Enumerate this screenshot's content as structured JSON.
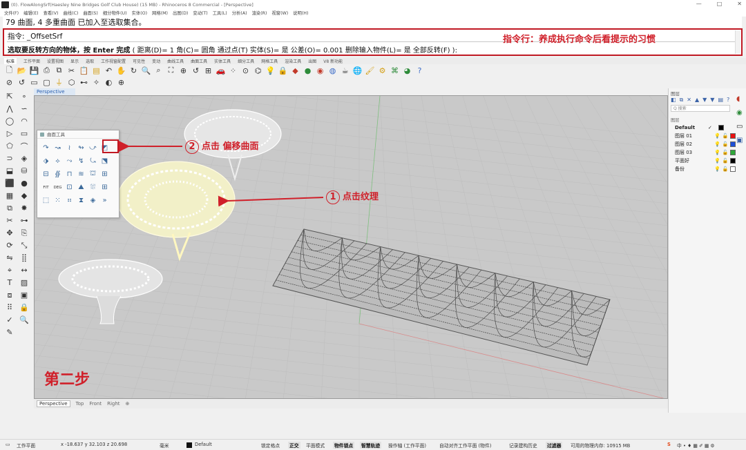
{
  "window": {
    "title": "(0). FlowAlongSrf(Haesley Nine Bridges Golf Club House) (15 MB) - Rhinoceros 8 Commercial - [Perspective]",
    "controls": [
      "—",
      "□",
      "✕"
    ]
  },
  "menu": [
    "文件(F)",
    "编辑(E)",
    "查看(V)",
    "曲线(C)",
    "曲面(S)",
    "细分物件(U)",
    "实体(O)",
    "网格(M)",
    "出图(D)",
    "变动(T)",
    "工具(L)",
    "分析(A)",
    "渲染(R)",
    "视窗(W)",
    "说明(H)"
  ],
  "command": {
    "history": "79 曲面, 4 多重曲面 已加入至选取集合。",
    "prompt": "指令: _OffsetSrf",
    "line2_bold": "选取要反转方向的物体，按 Enter 完成",
    "line2_opts": "( 距离(D)= 1  角(C)= 圆角  通过点(T)  实体(S)= 是  公差(O)= 0.001  删除输入物件(L)= 是  全部反转(F) ):",
    "annotation": "指令行：养成执行命令后看提示的习惯"
  },
  "toolbar_tabs": [
    "标准",
    "工作平面",
    "设置视图",
    "显示",
    "选取",
    "工作视窗配置",
    "可见性",
    "变动",
    "曲线工具",
    "曲面工具",
    "实体工具",
    "细分工具",
    "网格工具",
    "渲染工具",
    "出图",
    "V8 新功能"
  ],
  "toolbar_row1": [
    {
      "icon": "new-file-icon",
      "g": "🗋",
      "c": ""
    },
    {
      "icon": "open-icon",
      "g": "📂",
      "c": "c4"
    },
    {
      "icon": "save-icon",
      "g": "💾",
      "c": "c1"
    },
    {
      "icon": "print-icon",
      "g": "⎙",
      "c": ""
    },
    {
      "icon": "copy-icon",
      "g": "⧉",
      "c": ""
    },
    {
      "icon": "cut-icon",
      "g": "✂",
      "c": ""
    },
    {
      "icon": "paste-icon",
      "g": "📋",
      "c": ""
    },
    {
      "icon": "clipboard-icon",
      "g": "▤",
      "c": "c4"
    },
    {
      "icon": "undo-icon",
      "g": "↶",
      "c": ""
    },
    {
      "icon": "pan-icon",
      "g": "✋",
      "c": ""
    },
    {
      "icon": "rotate-icon",
      "g": "↻",
      "c": ""
    },
    {
      "icon": "zoom-icon",
      "g": "🔍",
      "c": ""
    },
    {
      "icon": "zoom-window-icon",
      "g": "⌕",
      "c": ""
    },
    {
      "icon": "zoom-extents-icon",
      "g": "⛶",
      "c": ""
    },
    {
      "icon": "zoom-selected-icon",
      "g": "⊕",
      "c": ""
    },
    {
      "icon": "undo-view-icon",
      "g": "↺",
      "c": ""
    },
    {
      "icon": "four-view-icon",
      "g": "⊞",
      "c": ""
    },
    {
      "icon": "car-icon",
      "g": "🚗",
      "c": "c2"
    },
    {
      "icon": "points-icon",
      "g": "⁘",
      "c": ""
    },
    {
      "icon": "snap-icon",
      "g": "⊙",
      "c": ""
    },
    {
      "icon": "cplane-icon",
      "g": "⌬",
      "c": ""
    },
    {
      "icon": "lightbulb-icon",
      "g": "💡",
      "c": "c4"
    },
    {
      "icon": "lock-icon",
      "g": "🔒",
      "c": ""
    },
    {
      "icon": "material-icon",
      "g": "◆",
      "c": "c2"
    },
    {
      "icon": "sphere-color-icon",
      "g": "●",
      "c": "c3"
    },
    {
      "icon": "render-sphere-icon",
      "g": "◉",
      "c": "c2"
    },
    {
      "icon": "environment-icon",
      "g": "◍",
      "c": "c1"
    },
    {
      "icon": "teapot-icon",
      "g": "☕",
      "c": ""
    },
    {
      "icon": "globe-icon",
      "g": "🌐",
      "c": "c1"
    },
    {
      "icon": "brush-icon",
      "g": "🖌",
      "c": "c4"
    },
    {
      "icon": "gear-icon",
      "g": "⚙",
      "c": "c4"
    },
    {
      "icon": "grasshopper-icon",
      "g": "⌘",
      "c": "c3"
    },
    {
      "icon": "rhino-render-icon",
      "g": "◕",
      "c": "c3"
    },
    {
      "icon": "help-icon",
      "g": "?",
      "c": "c1"
    }
  ],
  "toolbar_row2": [
    {
      "icon": "circle-select-icon",
      "g": "⊘",
      "c": ""
    },
    {
      "icon": "loop-icon",
      "g": "↺",
      "c": ""
    },
    {
      "icon": "panel-icon",
      "g": "▭",
      "c": ""
    },
    {
      "icon": "window-icon",
      "g": "▢",
      "c": ""
    },
    {
      "icon": "pipe-icon",
      "g": "⏚",
      "c": "c4"
    },
    {
      "icon": "hatch-icon",
      "g": "⬡",
      "c": ""
    },
    {
      "icon": "group-icon",
      "g": "⊷",
      "c": ""
    },
    {
      "icon": "wand-icon",
      "g": "✧",
      "c": ""
    },
    {
      "icon": "shade-icon",
      "g": "◐",
      "c": ""
    },
    {
      "icon": "target-icon",
      "g": "⊕",
      "c": ""
    }
  ],
  "left_tools": [
    {
      "n": "select-arrow-icon",
      "g": "⇱"
    },
    {
      "n": "point-icon",
      "g": "∘"
    },
    {
      "n": "polyline-icon",
      "g": "⋀"
    },
    {
      "n": "curve-icon",
      "g": "∽"
    },
    {
      "n": "circle-icon",
      "g": "◯"
    },
    {
      "n": "arc-icon",
      "g": "◠"
    },
    {
      "n": "triangle-icon",
      "g": "▷"
    },
    {
      "n": "rectangle-icon",
      "g": "▭"
    },
    {
      "n": "polygon-icon",
      "g": "⬠"
    },
    {
      "n": "fillet-icon",
      "g": "⌒"
    },
    {
      "n": "offset-curve-icon",
      "g": "⊃"
    },
    {
      "n": "surface-icon",
      "g": "◈"
    },
    {
      "n": "extrude-icon",
      "g": "⬓"
    },
    {
      "n": "loft-icon",
      "g": "⛁"
    },
    {
      "n": "box-icon",
      "g": "⬛"
    },
    {
      "n": "sphere-icon",
      "g": "●"
    },
    {
      "n": "mesh-icon",
      "g": "▦"
    },
    {
      "n": "subd-icon",
      "g": "◆"
    },
    {
      "n": "boolean-icon",
      "g": "⧉"
    },
    {
      "n": "explode-icon",
      "g": "✸"
    },
    {
      "n": "trim-icon",
      "g": "✂"
    },
    {
      "n": "join-icon",
      "g": "⊶"
    },
    {
      "n": "move-icon",
      "g": "✥"
    },
    {
      "n": "copy-obj-icon",
      "g": "⎘"
    },
    {
      "n": "rotate-obj-icon",
      "g": "⟳"
    },
    {
      "n": "scale-icon",
      "g": "⤡"
    },
    {
      "n": "mirror-icon",
      "g": "⇋"
    },
    {
      "n": "array-icon",
      "g": "⣿"
    },
    {
      "n": "analyze-icon",
      "g": "⌖"
    },
    {
      "n": "dimension-icon",
      "g": "↔"
    },
    {
      "n": "text-icon",
      "g": "T"
    },
    {
      "n": "hatch-tool-icon",
      "g": "▨"
    },
    {
      "n": "block-icon",
      "g": "⧈"
    },
    {
      "n": "layout-icon",
      "g": "▣"
    },
    {
      "n": "grid-dots-icon",
      "g": "⠿"
    },
    {
      "n": "lock-obj-icon",
      "g": "🔒"
    },
    {
      "n": "check-icon",
      "g": "✓"
    },
    {
      "n": "inspect-icon",
      "g": "🔍"
    },
    {
      "n": "paint-icon",
      "g": "✎"
    },
    {
      "n": "blank-icon",
      "g": ""
    }
  ],
  "viewport": {
    "active_label": "Perspective",
    "tabs": [
      "Perspective",
      "Top",
      "Front",
      "Right",
      "⊕"
    ]
  },
  "surface_panel": {
    "title": "曲面工具",
    "items": [
      {
        "n": "fillet-srf-icon",
        "g": "↷"
      },
      {
        "n": "variable-fillet-icon",
        "g": "↝"
      },
      {
        "n": "blend-srf-icon",
        "g": "≀"
      },
      {
        "n": "chamfer-srf-icon",
        "g": "↬"
      },
      {
        "n": "connect-srf-icon",
        "g": "⤻"
      },
      {
        "n": "offset-srf-icon",
        "g": "◩"
      },
      {
        "n": "extend-srf-icon",
        "g": "⬗"
      },
      {
        "n": "merge-srf-icon",
        "g": "⟡"
      },
      {
        "n": "match-srf-icon",
        "g": "⤳"
      },
      {
        "n": "rebuild-srf-icon",
        "g": "↯"
      },
      {
        "n": "uv-srf-icon",
        "g": "⤿"
      },
      {
        "n": "shrink-srf-icon",
        "g": "⬔"
      },
      {
        "n": "split-srf-icon",
        "g": "⊟"
      },
      {
        "n": "flow-srf-icon",
        "g": "∯"
      },
      {
        "n": "unroll-srf-icon",
        "g": "⊓"
      },
      {
        "n": "adjust-seam-icon",
        "g": "≋"
      },
      {
        "n": "loft-srf-icon",
        "g": "⛫"
      },
      {
        "n": "network-srf-icon",
        "g": "⊞"
      },
      {
        "n": "fit-srf-icon",
        "g": "FIT",
        "t": 1
      },
      {
        "n": "deg-srf-icon",
        "g": "DEG",
        "t": 1
      },
      {
        "n": "edge-tools-icon",
        "g": "⊡"
      },
      {
        "n": "patch-icon",
        "g": "⛰"
      },
      {
        "n": "drape-icon",
        "g": "⛆"
      },
      {
        "n": "grid-srf-icon",
        "g": "⊞"
      },
      {
        "n": "cage-icon",
        "g": "⬚"
      },
      {
        "n": "points-on-icon",
        "g": "⁙"
      },
      {
        "n": "control-pts-icon",
        "g": "⠶"
      },
      {
        "n": "twist-icon",
        "g": "⧗"
      },
      {
        "n": "sphere-srf-icon",
        "g": "◈"
      },
      {
        "n": "more-icon",
        "g": "»"
      }
    ]
  },
  "annotations": {
    "step2_num": "2",
    "step2_text": "点击 偏移曲面",
    "step1_num": "1",
    "step1_text": "点击纹理",
    "big": "第二步"
  },
  "layers_panel": {
    "title": "图层",
    "search_placeholder": "Q 搜索",
    "header": "图层",
    "layers": [
      {
        "name": "Default",
        "current": true,
        "color": "#000000"
      },
      {
        "name": "图层 01",
        "current": false,
        "color": "#e81010"
      },
      {
        "name": "图层 02",
        "current": false,
        "color": "#1c4fd8"
      },
      {
        "name": "图层 03",
        "current": false,
        "color": "#2fa83a"
      },
      {
        "name": "平面好",
        "current": false,
        "color": "#000000"
      },
      {
        "name": "备份",
        "current": false,
        "color": "#ffffff"
      }
    ]
  },
  "status": {
    "cplane": "工作平面",
    "coords": "x -18.637  y 32.103  z 20.698",
    "unit": "毫米",
    "layer": "Default",
    "items": [
      "锁定格点",
      "正交",
      "平面模式",
      "物件锁点",
      "智慧轨迹",
      "操作轴 (工作平面)",
      "自动对齐工作平面 (物件)",
      "记录建构历史",
      "过滤器",
      "可用的物理内存: 10915 MB"
    ]
  }
}
